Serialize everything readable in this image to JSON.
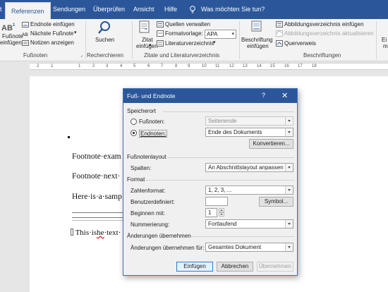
{
  "tabs": {
    "prev_partial": "t",
    "active": "Referenzen",
    "sendungen": "Sendungen",
    "ueberpruefen": "Überprüfen",
    "ansicht": "Ansicht",
    "hilfe": "Hilfe",
    "tell_me": "Was möchten Sie tun?"
  },
  "ribbon": {
    "fussnote_line1": "Fußnote",
    "fussnote_line2": "einfügen",
    "endnote_einfuegen": "Endnote einfügen",
    "naechste_fussnote": "Nächste Fußnote",
    "notizen_anzeigen": "Notizen anzeigen",
    "group_fussnoten": "Fußnoten",
    "suchen": "Suchen",
    "group_recherchieren": "Recherchieren",
    "zitat_line1": "Zitat",
    "zitat_line2": "einfügen",
    "quellen_verwalten": "Quellen verwalten",
    "formatvorlage": "Formatvorlage:",
    "formatvorlage_value": "APA",
    "literaturverzeichnis": "Literaturverzeichnis",
    "group_zitate": "Zitate und Literaturverzeichnis",
    "beschriftung_line1": "Beschriftung",
    "beschriftung_line2": "einfügen",
    "abbildungsverzeichnis_einfuegen": "Abbildungsverzeichnis einfügen",
    "abbildungsverzeichnis_aktualisieren": "Abbildungsverzeichnis aktualisieren",
    "querverweis": "Querverweis",
    "group_beschriftungen": "Beschriftungen",
    "right_partial_1": "Ei",
    "right_partial_2": "m"
  },
  "ruler": [
    "2",
    "1",
    "1",
    "2",
    "3",
    "4",
    "5",
    "6",
    "7",
    "8",
    "9",
    "10",
    "11",
    "12",
    "13",
    "14",
    "15",
    "16",
    "17",
    "18"
  ],
  "document": {
    "line1": "Footnote·exam",
    "line2": "Footnote·next·",
    "line3": "Here·is·a·samp",
    "footnote_prefix": "This·is",
    "footnote_he": "he",
    "footnote_rest": "·text·"
  },
  "dialog": {
    "title": "Fuß- und Endnote",
    "help": "?",
    "close": "✕",
    "speicherort": "Speicherort",
    "fussnoten_label": "Fußnoten:",
    "fussnoten_value": "Seitenende",
    "endnoten_label": "Endnoten:",
    "endnoten_value": "Ende des Dokuments",
    "konvertieren": "Konvertieren...",
    "fussnotenlayout": "Fußnotenlayout",
    "spalten_label": "Spalten:",
    "spalten_value": "An Abschnittslayout anpassen",
    "format": "Format",
    "zahlenformat_label": "Zahlenformat:",
    "zahlenformat_value": "1, 2, 3, ...",
    "benutzerdefiniert_label": "Benutzerdefiniert:",
    "symbol": "Symbol...",
    "beginnen_label": "Beginnen mit:",
    "beginnen_value": "1",
    "nummerierung_label": "Nummerierung:",
    "nummerierung_value": "Fortlaufend",
    "aenderungen": "Änderungen übernehmen",
    "aenderungen_label": "Änderungen übernehmen für:",
    "aenderungen_value": "Gesamtes Dokument",
    "einfuegen": "Einfügen",
    "abbrechen": "Abbrechen",
    "uebernehmen": "Übernehmen"
  }
}
